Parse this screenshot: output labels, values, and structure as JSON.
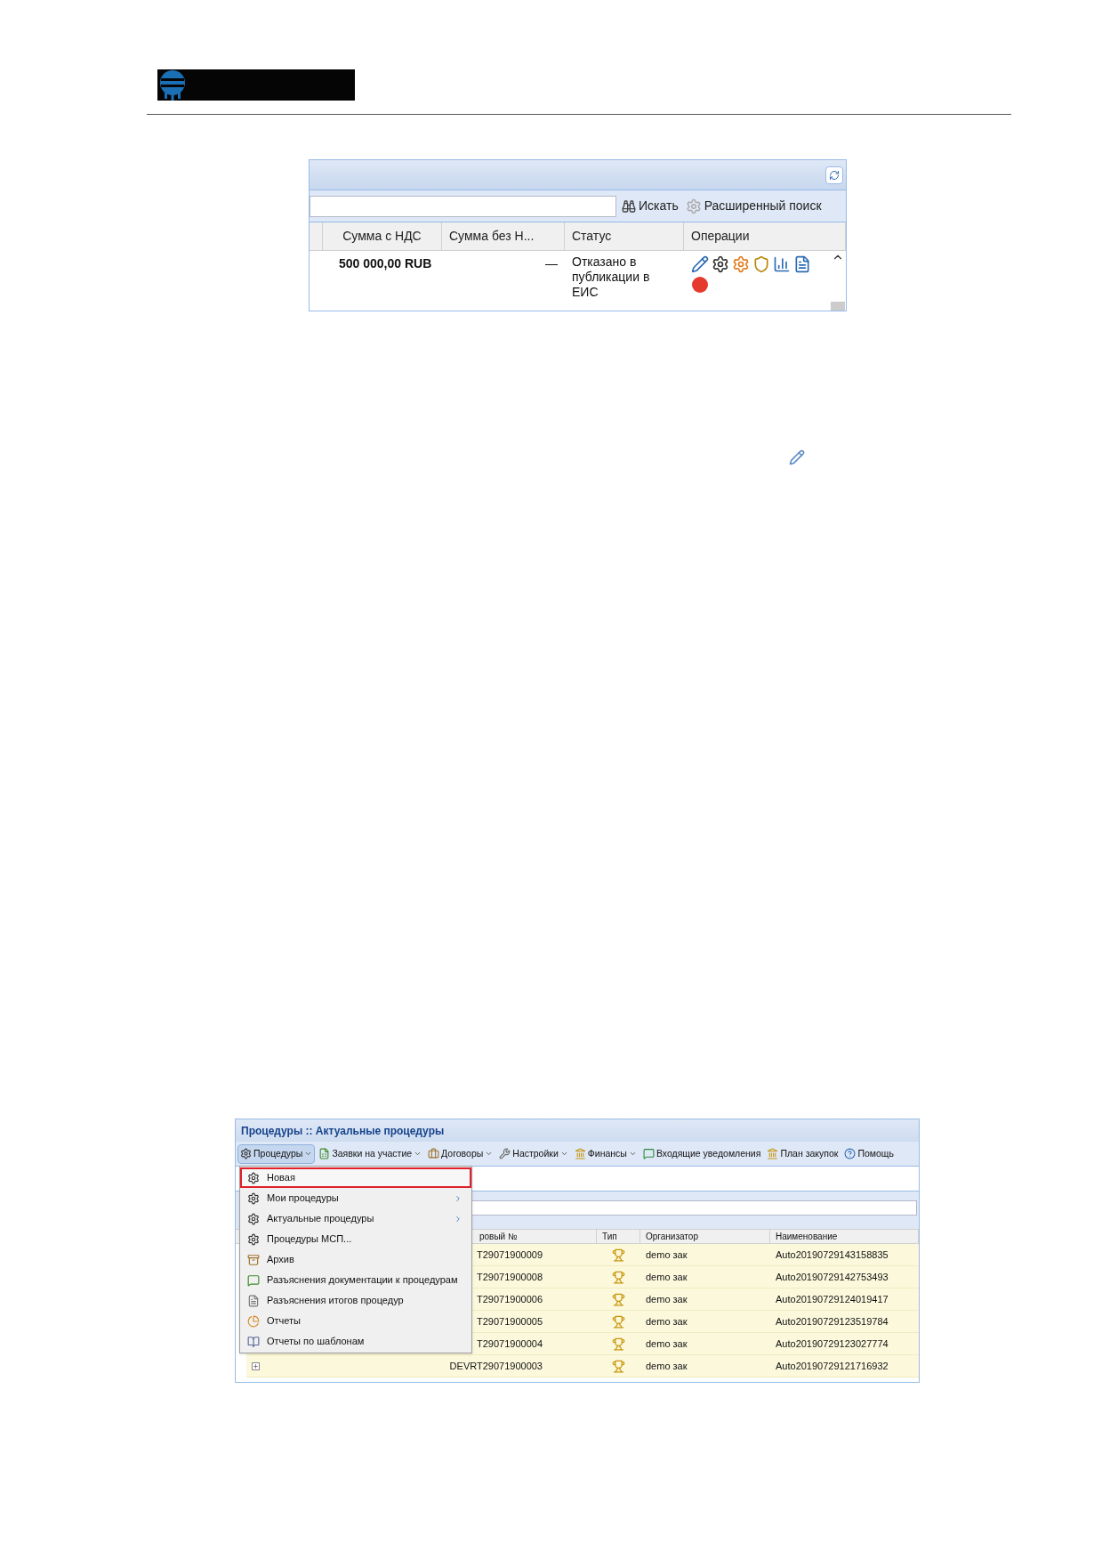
{
  "grid_panel": {
    "search_button": "Искать",
    "advanced_search_button": "Расширенный поиск",
    "columns": [
      "Сумма с НДС",
      "Сумма без Н...",
      "Статус",
      "Операции"
    ],
    "rows": [
      {
        "sum_with_vat": "500 000,00 RUB",
        "sum_without_vat": "—",
        "status": "Отказано в публикации в ЕИС"
      }
    ]
  },
  "procedures_window": {
    "title": "Процедуры :: Актуальные процедуры",
    "toolbar": [
      {
        "label": "Процедуры",
        "dropdown": true,
        "selected": true
      },
      {
        "label": "Заявки на участие",
        "dropdown": true,
        "selected": false
      },
      {
        "label": "Договоры",
        "dropdown": true,
        "selected": false
      },
      {
        "label": "Настройки",
        "dropdown": true,
        "selected": false
      },
      {
        "label": "Финансы",
        "dropdown": true,
        "selected": false
      },
      {
        "label": "Входящие уведомления",
        "dropdown": false,
        "selected": false
      },
      {
        "label": "План закупок",
        "dropdown": false,
        "selected": false
      },
      {
        "label": "Помощь",
        "dropdown": false,
        "selected": false
      }
    ],
    "menu": [
      {
        "label": "Новая",
        "selected": true,
        "submenu": false
      },
      {
        "label": "Мои процедуры",
        "selected": false,
        "submenu": true
      },
      {
        "label": "Актуальные процедуры",
        "selected": false,
        "submenu": true
      },
      {
        "label": "Процедуры МСП...",
        "selected": false,
        "submenu": false
      },
      {
        "label": "Архив",
        "selected": false,
        "submenu": false
      },
      {
        "label": "Разъяснения документации к процедурам",
        "selected": false,
        "submenu": false
      },
      {
        "label": "Разъяснения итогов процедур",
        "selected": false,
        "submenu": false
      },
      {
        "label": "Отчеты",
        "selected": false,
        "submenu": false
      },
      {
        "label": "Отчеты по шаблонам",
        "selected": false,
        "submenu": false
      }
    ],
    "columns": [
      "ровый №",
      "Тип",
      "Организатор",
      "Наименование"
    ],
    "rows": [
      {
        "number": "T29071900009",
        "organizer": "demo зак",
        "name": "Auto20190729143158835"
      },
      {
        "number": "T29071900008",
        "organizer": "demo зак",
        "name": "Auto20190729142753493"
      },
      {
        "number": "T29071900006",
        "organizer": "demo зак",
        "name": "Auto20190729124019417"
      },
      {
        "number": "T29071900005",
        "organizer": "demo зак",
        "name": "Auto20190729123519784"
      },
      {
        "number": "T29071900004",
        "organizer": "demo зак",
        "name": "Auto20190729123027774"
      },
      {
        "number": "DEVRT29071900003",
        "organizer": "demo зак",
        "name": "Auto20190729121716932",
        "expander": true
      }
    ]
  }
}
